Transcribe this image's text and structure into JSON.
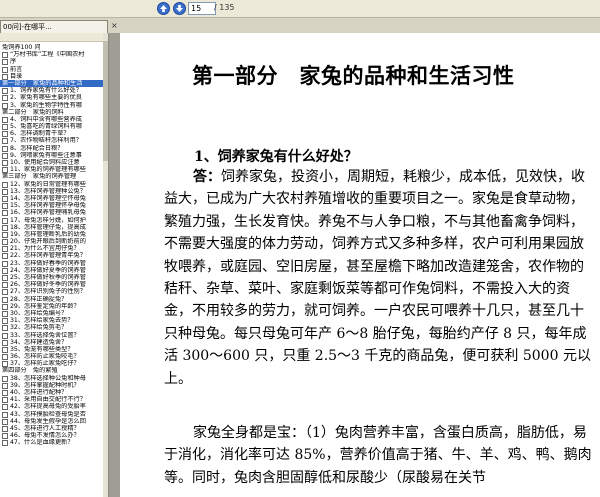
{
  "toolbar": {
    "up_icon": "arrow-up-icon",
    "down_icon": "arrow-down-icon",
    "page_value": "15",
    "page_total": "/ 135"
  },
  "tab": {
    "label": "00问]-在哪平...",
    "close": "×"
  },
  "sidebar": {
    "collapse": "◂",
    "items": [
      {
        "text": "兔饲养100 问",
        "level": 0,
        "selected": false
      },
      {
        "text": "“万村书库”工程《中国农村",
        "level": 1,
        "selected": false
      },
      {
        "text": "序",
        "level": 1,
        "selected": false
      },
      {
        "text": "前言",
        "level": 1,
        "selected": false
      },
      {
        "text": "目录",
        "level": 1,
        "selected": false
      },
      {
        "text": "第一部分　家兔的品种和生活",
        "level": 0,
        "selected": true
      },
      {
        "text": "1、饲养家兔有什么好处？",
        "level": 1,
        "selected": false
      },
      {
        "text": "2、家兔有哪些主要的优良",
        "level": 1,
        "selected": false
      },
      {
        "text": "3、家兔的生物学特性有哪",
        "level": 1,
        "selected": false
      },
      {
        "text": "第二部分　家兔的饲料",
        "level": 0,
        "selected": false
      },
      {
        "text": "4、饲料中含有哪些营养成",
        "level": 1,
        "selected": false
      },
      {
        "text": "5、兔喜吃的青绿饲料有哪",
        "level": 1,
        "selected": false
      },
      {
        "text": "6、怎样调制青干草？",
        "level": 1,
        "selected": false
      },
      {
        "text": "7、农作物秸秆怎样利用？",
        "level": 1,
        "selected": false
      },
      {
        "text": "8、怎样配合日粮？",
        "level": 1,
        "selected": false
      },
      {
        "text": "9、饲喂家兔有哪些注意事",
        "level": 1,
        "selected": false
      },
      {
        "text": "10、使用配合饲料应注意",
        "level": 1,
        "selected": false
      },
      {
        "text": "11、家兔的饲养管理有哪些",
        "level": 1,
        "selected": false
      },
      {
        "text": "第三部分　家兔的饲养管理",
        "level": 0,
        "selected": false
      },
      {
        "text": "12、家兔的日常管理有哪些",
        "level": 1,
        "selected": false
      },
      {
        "text": "13、怎样饲养管理种公兔？",
        "level": 1,
        "selected": false
      },
      {
        "text": "14、怎样饲养管理空怀母兔",
        "level": 1,
        "selected": false
      },
      {
        "text": "15、怎样饲养管理怀孕母兔",
        "level": 1,
        "selected": false
      },
      {
        "text": "16、怎样饲养管理哺乳母兔",
        "level": 1,
        "selected": false
      },
      {
        "text": "17、母兔怎样分娩，如何护",
        "level": 1,
        "selected": false
      },
      {
        "text": "18、怎样管理仔兔，提高成",
        "level": 1,
        "selected": false
      },
      {
        "text": "19、怎样管理断乳后的幼兔",
        "level": 1,
        "selected": false
      },
      {
        "text": "20、仔兔开眼后到断奶前的",
        "level": 1,
        "selected": false
      },
      {
        "text": "21、为什么不宜用仔兔？",
        "level": 1,
        "selected": false
      },
      {
        "text": "22、怎样饲养管理青年兔？",
        "level": 1,
        "selected": false
      },
      {
        "text": "23、怎样做好春季的饲养管",
        "level": 1,
        "selected": false
      },
      {
        "text": "24、怎样做好夏季的饲养管",
        "level": 1,
        "selected": false
      },
      {
        "text": "25、怎样做好秋季的饲养管",
        "level": 1,
        "selected": false
      },
      {
        "text": "26、怎样做好冬季的饲养管",
        "level": 1,
        "selected": false
      },
      {
        "text": "27、怎样识别兔子的性别？",
        "level": 1,
        "selected": false
      },
      {
        "text": "28、怎样正确捉兔？",
        "level": 1,
        "selected": false
      },
      {
        "text": "29、怎样鉴定兔的年龄？",
        "level": 1,
        "selected": false
      },
      {
        "text": "30、怎样给兔编号？",
        "level": 1,
        "selected": false
      },
      {
        "text": "31、怎样给家兔去势？",
        "level": 1,
        "selected": false
      },
      {
        "text": "32、怎样给兔剪毛？",
        "level": 1,
        "selected": false
      },
      {
        "text": "33、怎样选择兔舍位置？",
        "level": 1,
        "selected": false
      },
      {
        "text": "34、怎样建造兔舍？",
        "level": 1,
        "selected": false
      },
      {
        "text": "35、兔笼有哪些类型？",
        "level": 1,
        "selected": false
      },
      {
        "text": "36、怎样防止家兔咬毛？",
        "level": 1,
        "selected": false
      },
      {
        "text": "37、怎样防止家兔吃仔？",
        "level": 1,
        "selected": false
      },
      {
        "text": "第四部分　兔的繁殖",
        "level": 0,
        "selected": false
      },
      {
        "text": "38、怎样选择种公兔和种母",
        "level": 1,
        "selected": false
      },
      {
        "text": "39、怎样掌握配种时机？",
        "level": 1,
        "selected": false
      },
      {
        "text": "40、怎样进行配种？",
        "level": 1,
        "selected": false
      },
      {
        "text": "41、采用自由交配行不行？",
        "level": 1,
        "selected": false
      },
      {
        "text": "42、怎样提高母兔的受胎率",
        "level": 1,
        "selected": false
      },
      {
        "text": "43、怎样摸胎检查母兔是否",
        "level": 1,
        "selected": false
      },
      {
        "text": "44、母兔发生假孕是怎么回",
        "level": 1,
        "selected": false
      },
      {
        "text": "45、怎样进行人工授精？",
        "level": 1,
        "selected": false
      },
      {
        "text": "46、母兔不发情怎么办？",
        "level": 1,
        "selected": false
      },
      {
        "text": "47、什么是血缘更新？",
        "level": 1,
        "selected": false
      }
    ]
  },
  "document": {
    "title": "第一部分　家兔的品种和生活习性",
    "question": "1、饲养家兔有什么好处？",
    "p1_lead": "答：",
    "p1": "饲养家兔，投资小，周期短，耗粮少，成本低，见效快，收益大，已成为广大农村养殖增收的重要项目之一。家兔是食草动物，繁殖力强，生长发育快。养兔不与人争口粮，不与其他畜禽争饲料，不需要大强度的体力劳动，饲养方式又多种多样，农户可利用果园放牧喂养，或庭园、空旧房屋，甚至屋檐下略加改造建笼舍，农作物的秸秆、杂草、菜叶、家庭剩饭菜等都可作兔饲料，不需投入大的资金，不用较多的劳力，就可饲养。一户农民可喂养十几只，甚至几十只种母兔。每只母兔可年产 6～8 胎仔兔，每胎约产仔 8 只，每年成活 300～600 只，只重 2.5～3 千克的商品兔，便可获利 5000 元以上。",
    "p2": "家兔全身都是宝：（1）兔肉营养丰富，含蛋白质高，脂肪低，易于消化，消化率可达 85%，营养价值高于猪、牛、羊、鸡、鸭、鹅肉等。同时，兔肉含胆固醇低和尿酸少（尿酸易在关节"
  }
}
